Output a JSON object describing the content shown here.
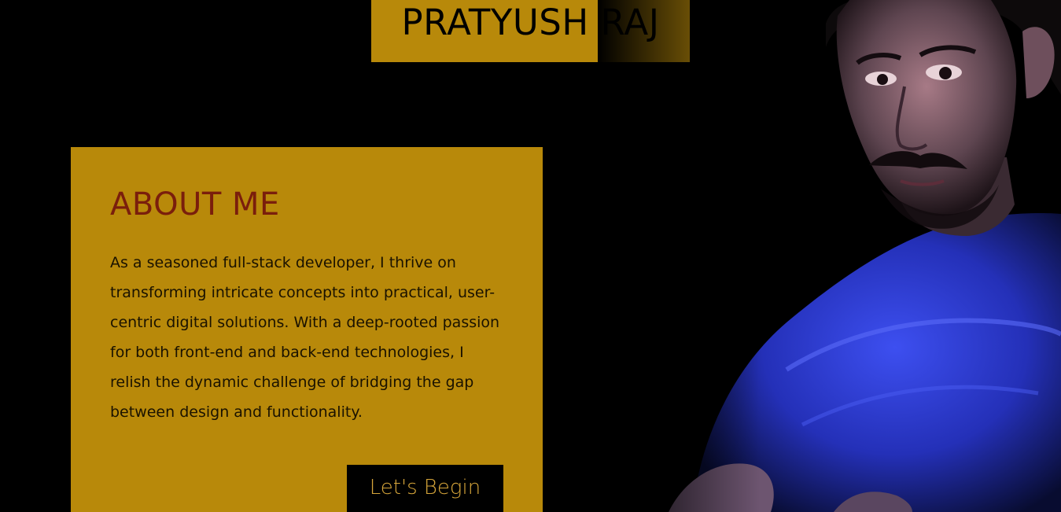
{
  "header": {
    "name": "PRATYUSH RAJ"
  },
  "about": {
    "title": "ABOUT ME",
    "body": "As a seasoned full-stack developer, I thrive on transforming intricate concepts into practical, user-centric digital solutions. With a deep-rooted passion for both front-end and back-end technologies, I relish the dynamic challenge of bridging the gap between design and functionality.",
    "cta_label": "Let's Begin"
  },
  "theme": {
    "background": "#000000",
    "accent": "#b8890a",
    "title_color": "#7a1e0c",
    "button_text": "#d6a53a"
  },
  "portrait": {
    "icon": "person-portrait-photo"
  }
}
